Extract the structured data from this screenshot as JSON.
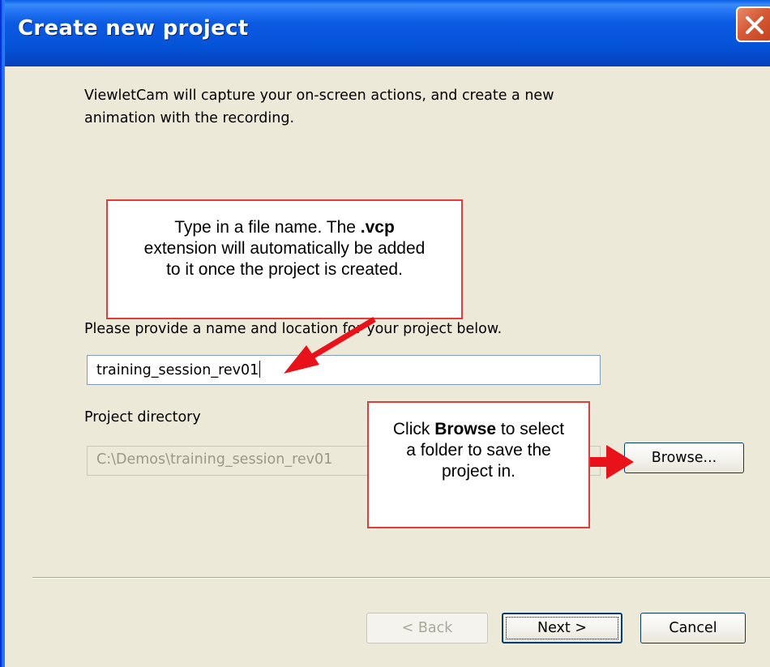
{
  "window": {
    "title": "Create new project"
  },
  "intro": {
    "line1": "ViewletCam will capture your on-screen actions, and create a new",
    "line2": "animation with the recording."
  },
  "callout_name": {
    "line1": "Type in a file name. The ",
    "line1_bold": ".vcp",
    "line2": "extension will automatically be added",
    "line3": "to it once the project is created."
  },
  "name_label": "Please provide a name and location for your project below.",
  "name_input": {
    "value": "training_session_rev01"
  },
  "dir_label": "Project directory",
  "dir_input": {
    "value": "C:\\Demos\\training_session_rev01"
  },
  "callout_browse": {
    "line1_pre": "Click ",
    "line1_bold": "Browse",
    "line1_post": " to select",
    "line2": "a folder to save the",
    "line3": "project in."
  },
  "buttons": {
    "browse": "Browse...",
    "back": "< Back",
    "next": "Next >",
    "cancel": "Cancel"
  },
  "colors": {
    "titlebar": "#0554d8",
    "dialog_bg": "#ece9d8",
    "callout_border": "#e53b3b",
    "arrow": "#e8121b"
  }
}
